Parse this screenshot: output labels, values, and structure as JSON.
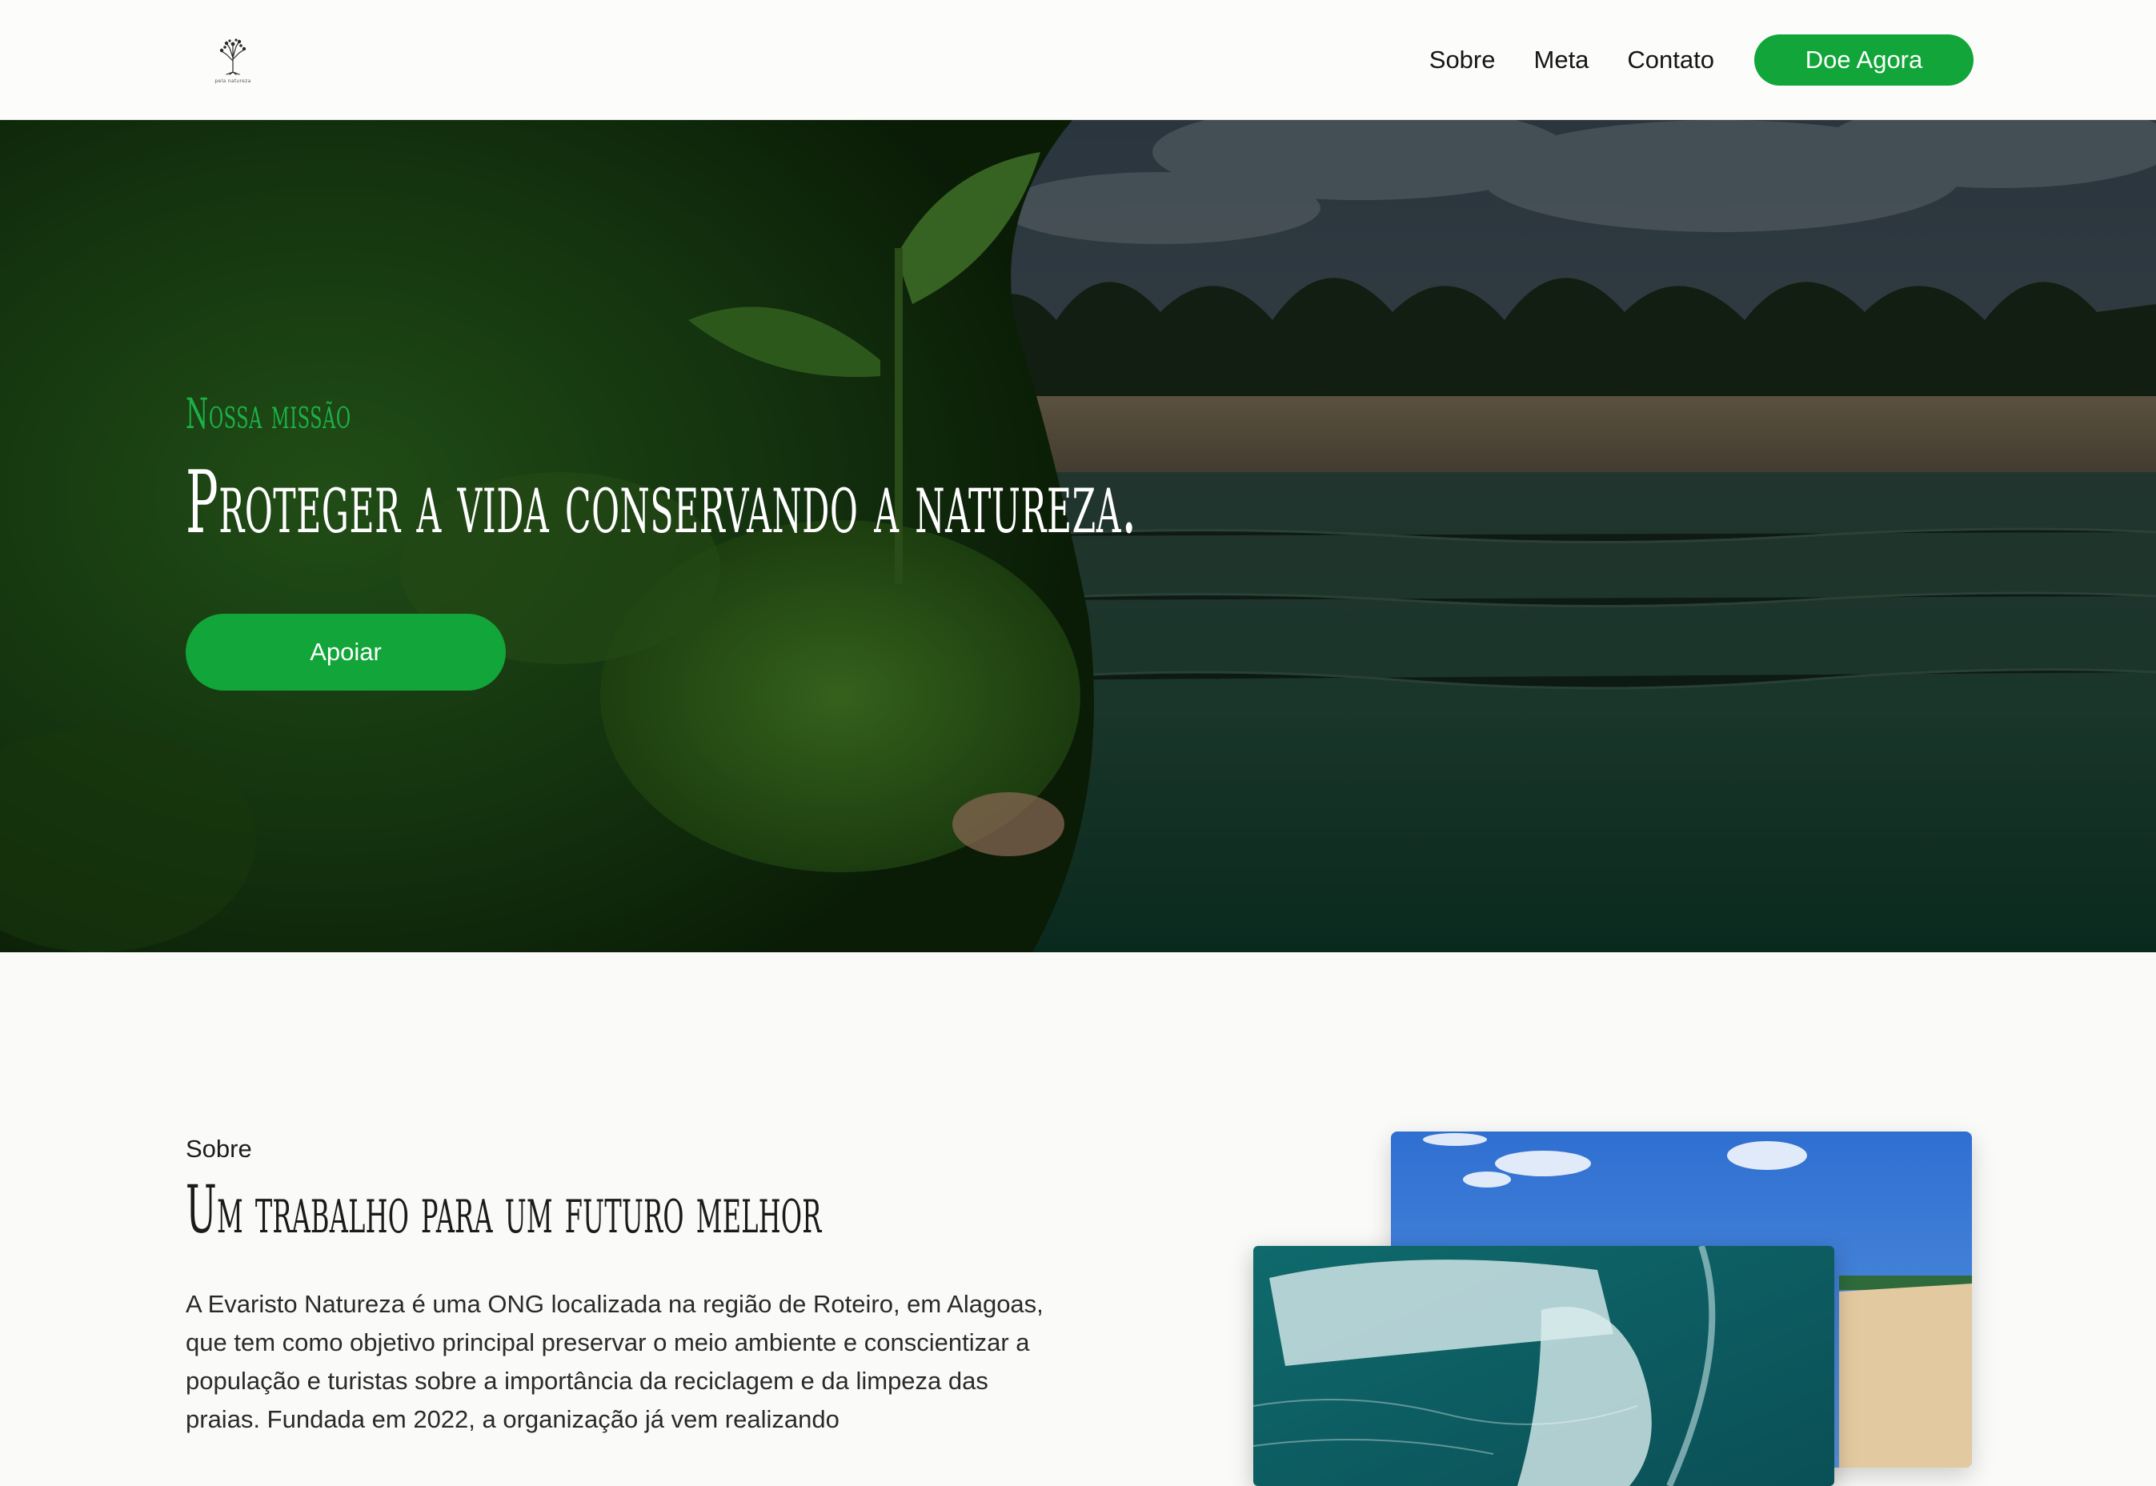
{
  "header": {
    "logo_text": "pela natureza",
    "nav": [
      {
        "label": "Sobre"
      },
      {
        "label": "Meta"
      },
      {
        "label": "Contato"
      }
    ],
    "donate_label": "Doe Agora"
  },
  "hero": {
    "kicker": "Nossa missão",
    "title": "Proteger a vida conservando a natureza.",
    "button_label": "Apoiar"
  },
  "about": {
    "kicker": "Sobre",
    "title": "Um trabalho para um futuro melhor",
    "text": "A Evaristo Natureza é uma ONG localizada na região de Roteiro, em Alagoas, que tem como objetivo principal preservar o meio ambiente e conscientizar a população e turistas sobre a importância da reciclagem e da limpeza das praias. Fundada em 2022, a organização já vem realizando"
  },
  "colors": {
    "accent": "#12a539",
    "kicker_green": "#1cb046",
    "page_bg": "#fafbf9"
  }
}
